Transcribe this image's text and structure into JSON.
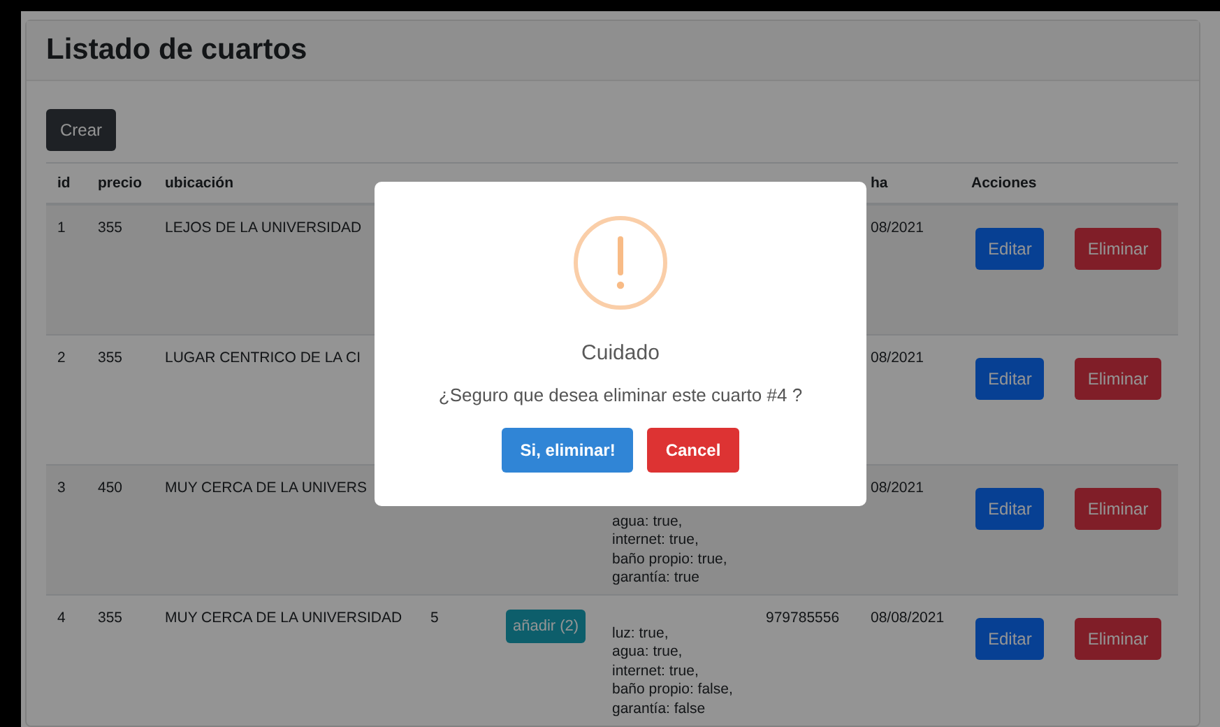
{
  "page_title": "Listado de cuartos",
  "create_button": "Crear",
  "table": {
    "columns": [
      {
        "label": "id"
      },
      {
        "label": "precio"
      },
      {
        "label": "ubicación"
      },
      {},
      {},
      {},
      {},
      {
        "label": "ha"
      },
      {
        "label": "Acciones"
      }
    ],
    "rows": [
      {
        "id": "1",
        "precio": "355",
        "ubicacion": "LEJOS DE LA UNIVERSIDAD",
        "fecha": "08/2021",
        "actions": [
          "Editar",
          "Eliminar"
        ]
      },
      {
        "id": "2",
        "precio": "355",
        "ubicacion": "LUGAR CENTRICO DE LA CI",
        "fecha": "08/2021",
        "actions": [
          "Editar",
          "Eliminar"
        ]
      },
      {
        "id": "3",
        "precio": "450",
        "ubicacion": "MUY CERCA DE LA UNIVERS",
        "column_6": [
          "agua: true,",
          "internet: true,",
          "baño propio: true,",
          "garantía: true"
        ],
        "fecha": "08/2021",
        "actions": [
          "Editar",
          "Eliminar"
        ]
      },
      {
        "id": "4",
        "precio": "355",
        "ubicacion": "MUY CERCA DE LA UNIVERSIDAD",
        "column_4": "5",
        "column_5": "añadir (2)",
        "column_6": [
          "luz: true,",
          "agua: true,",
          "internet: true,",
          "baño propio: false,",
          "garantía: false"
        ],
        "column_7": "979785556",
        "fecha": "08/08/2021",
        "actions": [
          "Editar",
          "Eliminar"
        ]
      }
    ]
  },
  "dialog": {
    "title": "Cuidado",
    "message": "¿Seguro que desea eliminar este cuarto #4 ?",
    "confirm_button": "Si, eliminar!",
    "cancel_button": "Cancel"
  }
}
